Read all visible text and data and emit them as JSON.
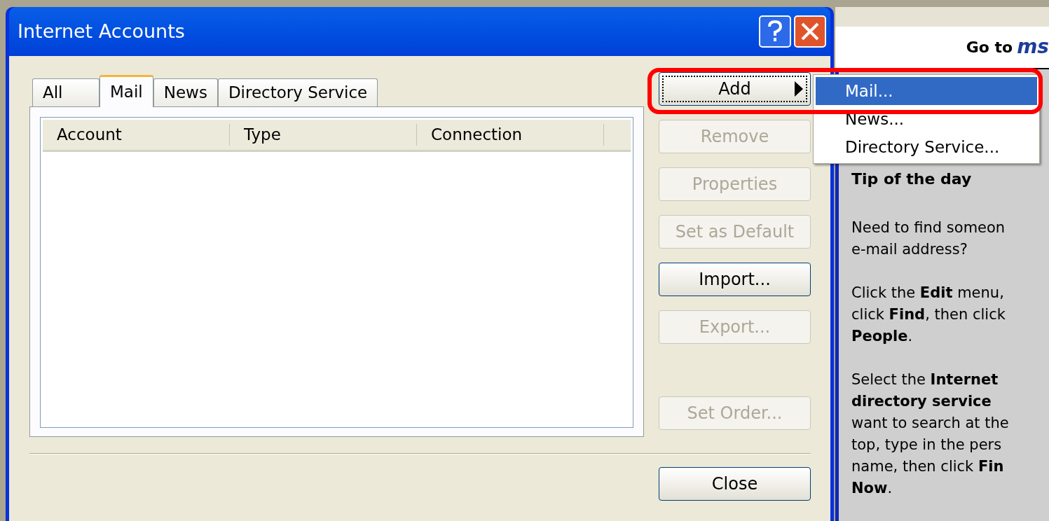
{
  "window": {
    "title": "Internet Accounts"
  },
  "tabs": [
    {
      "label": "All",
      "selected": false
    },
    {
      "label": "Mail",
      "selected": true
    },
    {
      "label": "News",
      "selected": false
    },
    {
      "label": "Directory Service",
      "selected": false
    }
  ],
  "list": {
    "columns": [
      "Account",
      "Type",
      "Connection"
    ]
  },
  "buttons": [
    {
      "label": "Add",
      "disabled": false,
      "focused": true,
      "submenu": true
    },
    {
      "label": "Remove",
      "disabled": true,
      "focused": false,
      "submenu": false
    },
    {
      "label": "Properties",
      "disabled": true,
      "focused": false,
      "submenu": false
    },
    {
      "label": "Set as Default",
      "disabled": true,
      "focused": false,
      "submenu": false
    },
    {
      "label": "Import...",
      "disabled": false,
      "focused": false,
      "submenu": false
    },
    {
      "label": "Export...",
      "disabled": true,
      "focused": false,
      "submenu": false
    }
  ],
  "order_button": {
    "label": "Set Order...",
    "disabled": true
  },
  "close_button": {
    "label": "Close",
    "disabled": false
  },
  "add_menu": [
    {
      "label": "Mail...",
      "selected": true
    },
    {
      "label": "News...",
      "selected": false
    },
    {
      "label": "Directory Service...",
      "selected": false
    }
  ],
  "side_panel": {
    "goto": "Go to",
    "logo": "ms",
    "tip_title": "Tip of the day",
    "paragraphs": [
      [
        "Need to find someon",
        "e-mail address?"
      ],
      [
        "Click the **Edit** menu,",
        "click **Find**, then click",
        "**People**."
      ],
      [
        "Select the **Internet**",
        "**directory service**",
        "want to search at the",
        "top, type in the pers",
        "name, then click **Fin**",
        "**Now**."
      ]
    ]
  }
}
